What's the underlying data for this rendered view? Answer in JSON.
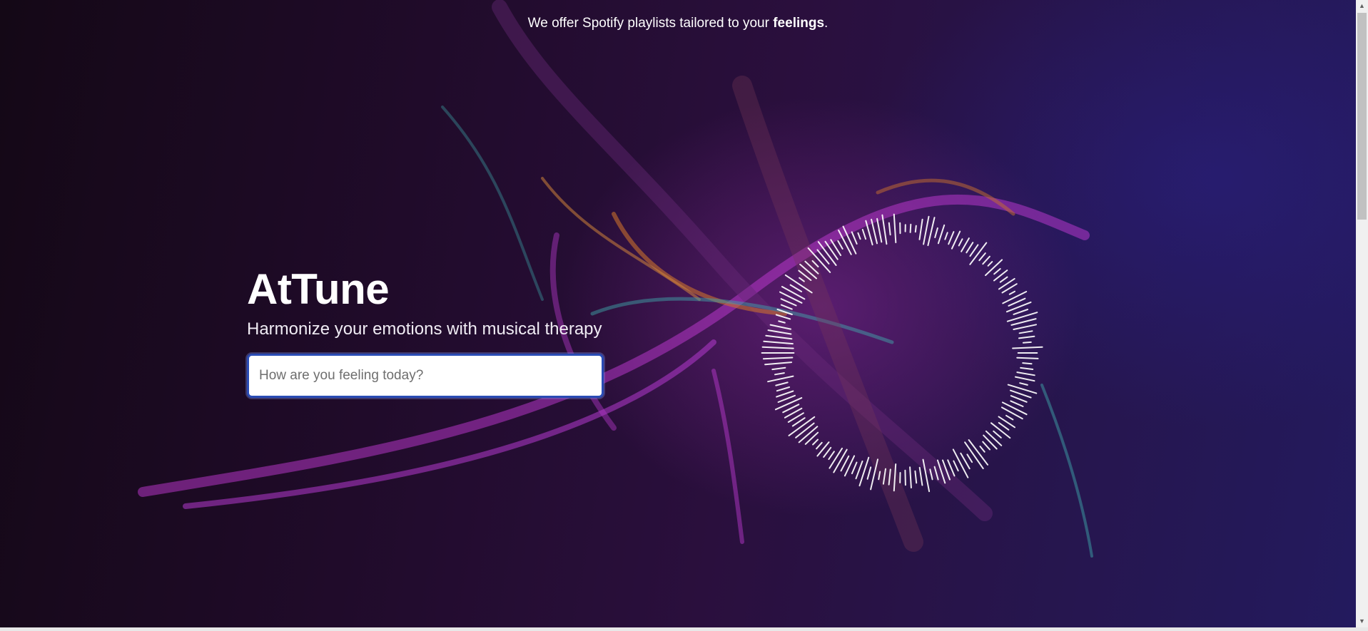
{
  "header": {
    "tagline_prefix": "We offer Spotify playlists tailored to your ",
    "tagline_emphasis": "feelings",
    "tagline_suffix": "."
  },
  "hero": {
    "title": "AtTune",
    "subtitle": "Harmonize your emotions with musical therapy"
  },
  "mood_input": {
    "value": "",
    "placeholder": "How are you feeling today?"
  },
  "colors": {
    "background_dark": "#1a0a24",
    "background_blue": "#231a5e",
    "input_border": "#2a4cb5",
    "accent_magenta": "#c23bd6",
    "accent_teal": "#3fb0b0",
    "accent_orange": "#d97a2a"
  },
  "scrollbar": {
    "up_icon": "triangle-up",
    "down_icon": "triangle-down"
  }
}
